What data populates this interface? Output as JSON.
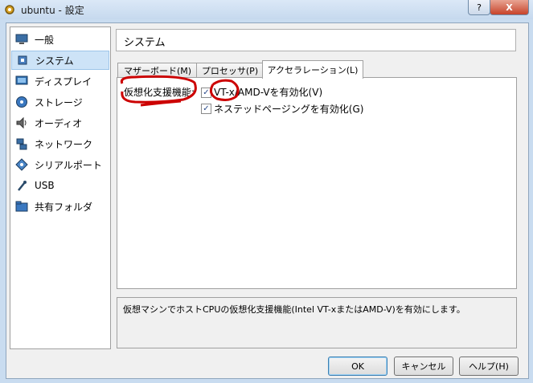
{
  "window": {
    "title": "ubuntu - 設定",
    "help_label": "?",
    "close_label": "X"
  },
  "sidebar": {
    "items": [
      {
        "label": "一般",
        "icon": "monitor-icon"
      },
      {
        "label": "システム",
        "icon": "chip-icon"
      },
      {
        "label": "ディスプレイ",
        "icon": "display-icon"
      },
      {
        "label": "ストレージ",
        "icon": "disk-icon"
      },
      {
        "label": "オーディオ",
        "icon": "speaker-icon"
      },
      {
        "label": "ネットワーク",
        "icon": "network-icon"
      },
      {
        "label": "シリアルポート",
        "icon": "serial-port-icon"
      },
      {
        "label": "USB",
        "icon": "usb-icon"
      },
      {
        "label": "共有フォルダ",
        "icon": "folder-icon"
      }
    ],
    "selected_index": 1
  },
  "page": {
    "title": "システム"
  },
  "tabs": [
    {
      "label": "マザーボード(M)"
    },
    {
      "label": "プロセッサ(P)"
    },
    {
      "label": "アクセラレーション(L)"
    }
  ],
  "acceleration": {
    "group_label": "仮想化支援機能:",
    "vtx_label": "VT-x/AMD-Vを有効化(V)",
    "vtx_checked": true,
    "nested_paging_label": "ネステッドページングを有効化(G)",
    "nested_paging_checked": true
  },
  "description": "仮想マシンでホストCPUの仮想化支援機能(Intel VT-xまたはAMD-V)を有効にします。",
  "buttons": {
    "ok": "OK",
    "cancel": "キャンセル",
    "help": "ヘルプ(H)"
  },
  "colors": {
    "annotation": "#cc0000",
    "selection": "#cde3f7",
    "check": "#2a4a8a"
  }
}
